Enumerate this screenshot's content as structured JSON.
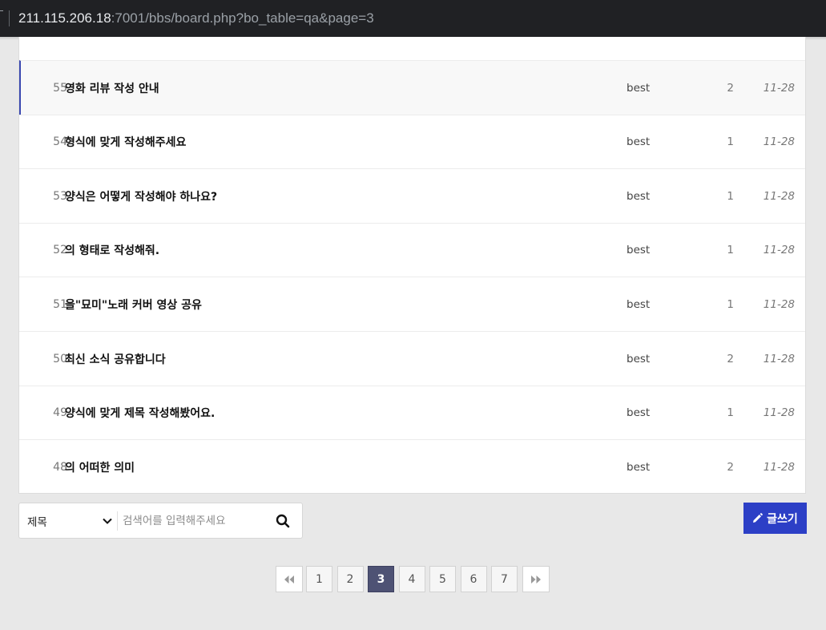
{
  "browser": {
    "url_host": "211.115.206.18",
    "url_rest": ":7001/bbs/board.php?bo_table=qa&page=3"
  },
  "board": {
    "rows": [
      {
        "num": "55",
        "subject": "영화 리뷰 작성 안내",
        "name": "best",
        "hit": "2",
        "date": "11-28",
        "active": true
      },
      {
        "num": "54",
        "subject": "형식에 맞게 작성해주세요",
        "name": "best",
        "hit": "1",
        "date": "11-28"
      },
      {
        "num": "53",
        "subject": "양식은 어떻게 작성해야 하나요?",
        "name": "best",
        "hit": "1",
        "date": "11-28"
      },
      {
        "num": "52",
        "subject": "의 형태로 작성해줘.",
        "name": "best",
        "hit": "1",
        "date": "11-28"
      },
      {
        "num": "51",
        "subject": "을\"묘미\"노래 커버 영상 공유",
        "name": "best",
        "hit": "1",
        "date": "11-28"
      },
      {
        "num": "50",
        "subject": "최신 소식 공유합니다",
        "name": "best",
        "hit": "2",
        "date": "11-28"
      },
      {
        "num": "49",
        "subject": "양식에 맞게 제목 작성해봤어요.",
        "name": "best",
        "hit": "1",
        "date": "11-28"
      },
      {
        "num": "48",
        "subject": "의 어떠한 의미",
        "name": "best",
        "hit": "2",
        "date": "11-28"
      }
    ]
  },
  "search": {
    "field_selected": "제목",
    "placeholder": "검색어를 입력해주세요",
    "search_icon": "search-icon"
  },
  "write_button": {
    "label": "글쓰기",
    "icon": "pencil-icon",
    "color": "#2c3fc6"
  },
  "pagination": {
    "first_icon": "double-chevron-left-icon",
    "last_icon": "double-chevron-right-icon",
    "pages": [
      "1",
      "2",
      "3",
      "4",
      "5",
      "6",
      "7"
    ],
    "current": "3"
  },
  "colors": {
    "active_row_accent": "#3a48b0",
    "current_page": "#4e5274"
  }
}
